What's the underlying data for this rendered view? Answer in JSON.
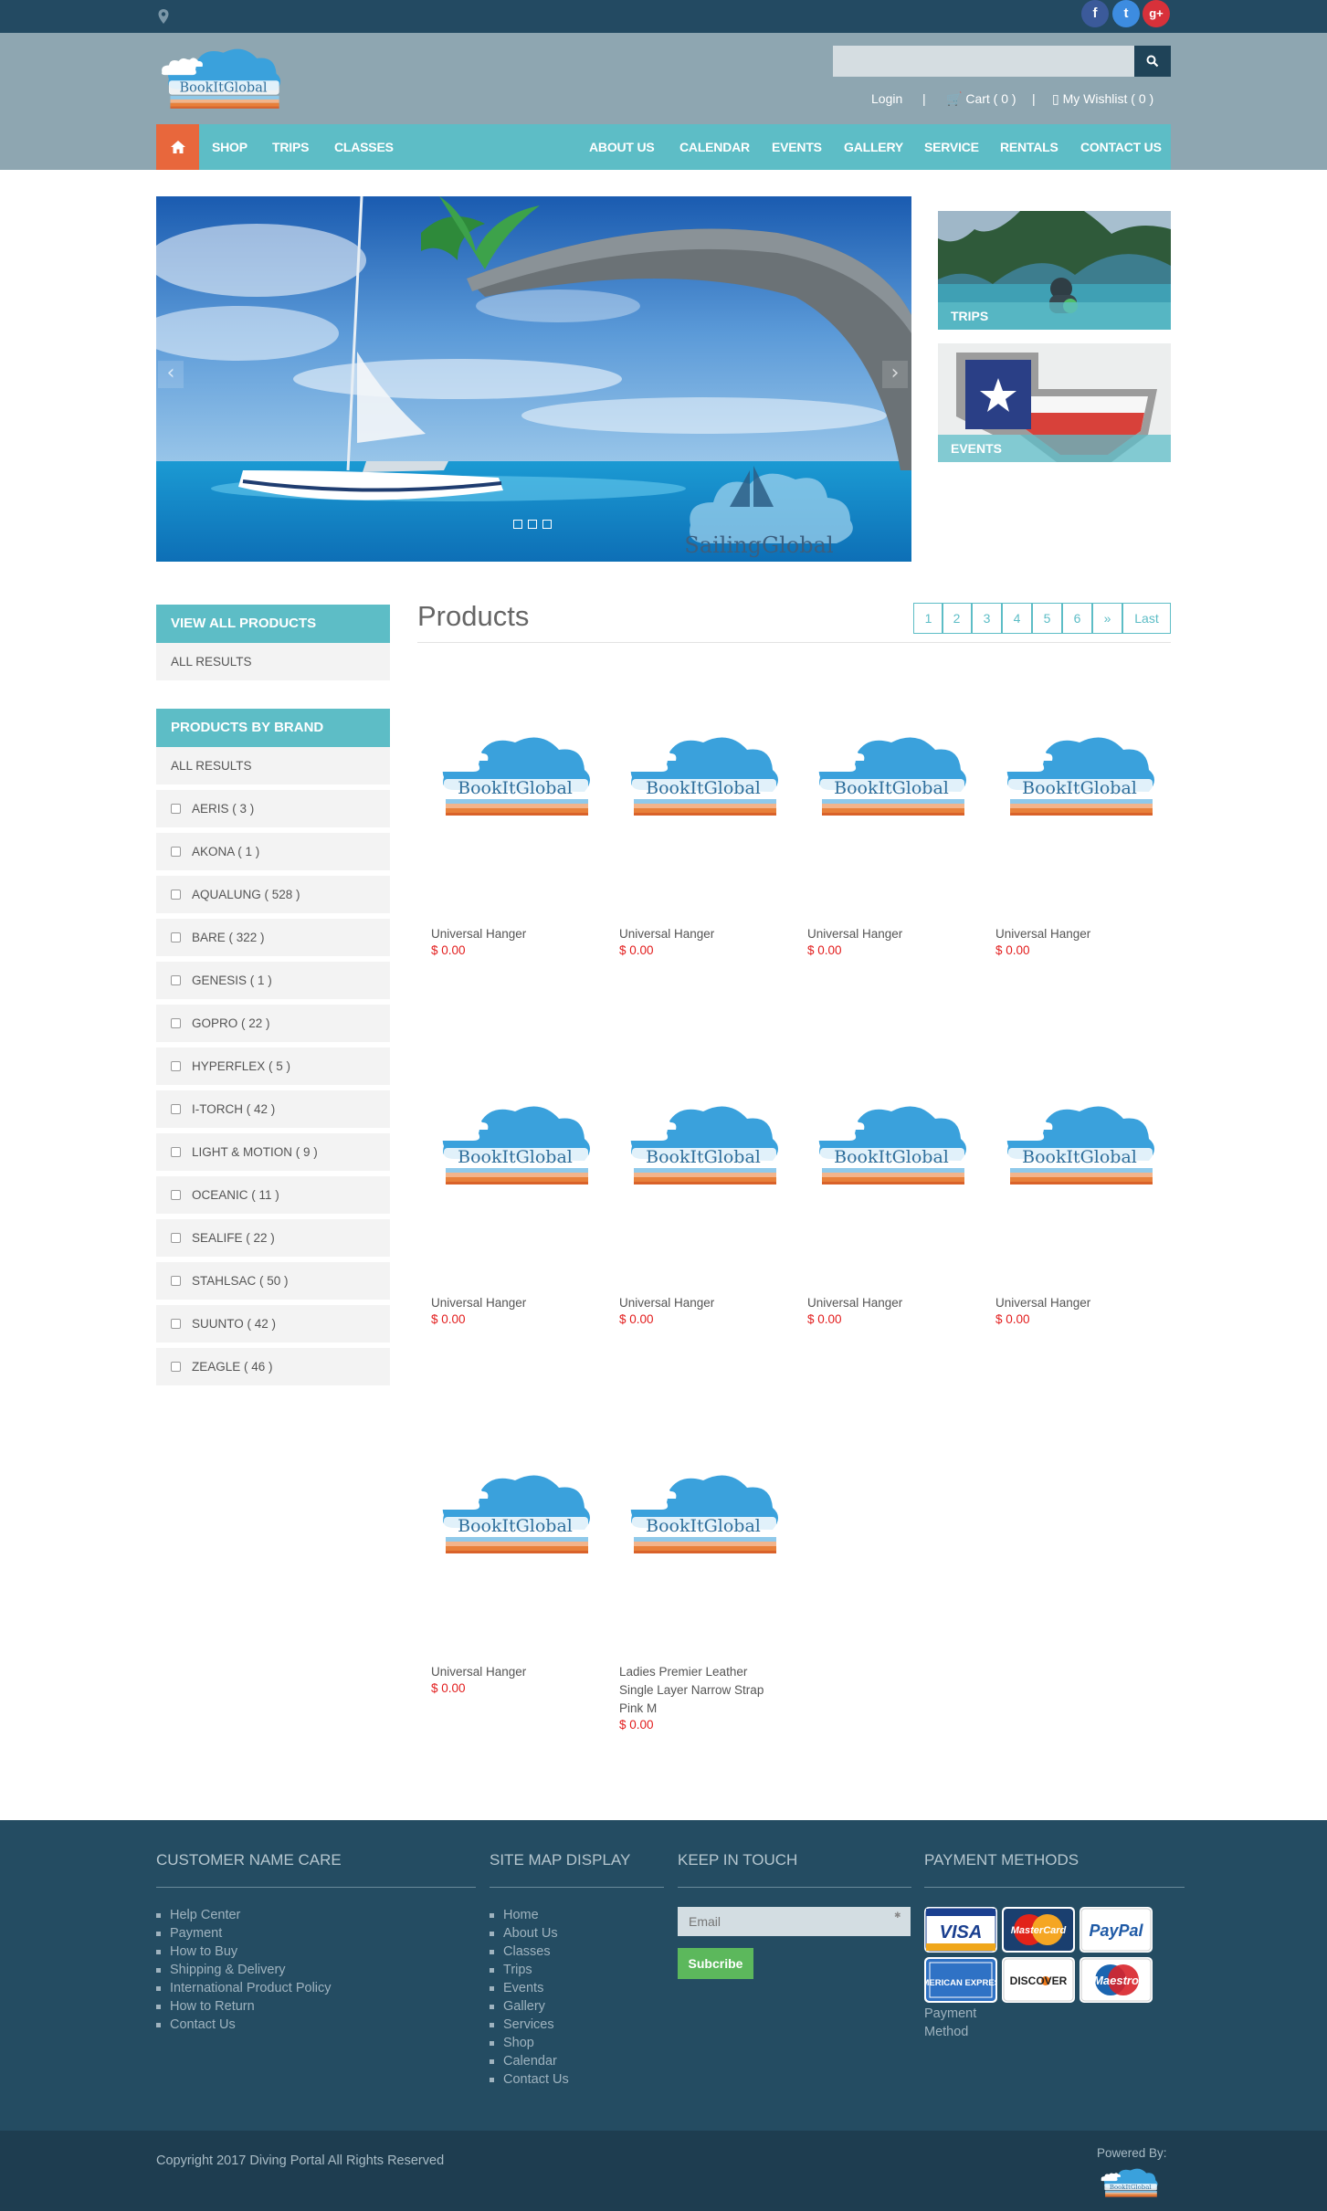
{
  "topbar": {
    "social": [
      "f",
      "t",
      "g+"
    ]
  },
  "header": {
    "logo_text": "BookItGlobal",
    "search": {
      "placeholder": ""
    },
    "account": {
      "login": "Login",
      "separator": "|",
      "cart": "Cart ( 0 )",
      "wishlist": "My Wishlist ( 0 )"
    }
  },
  "nav": {
    "left": [
      "SHOP",
      "TRIPS",
      "CLASSES"
    ],
    "right": [
      "ABOUT US",
      "CALENDAR",
      "EVENTS",
      "GALLERY",
      "SERVICE",
      "RENTALS",
      "CONTACT US"
    ]
  },
  "hero": {
    "watermark": "SailingGlobal",
    "tiles": [
      "TRIPS",
      "EVENTS"
    ],
    "slide_count": 3
  },
  "sidebar": {
    "view_all": {
      "title": "VIEW ALL PRODUCTS",
      "all_results": "ALL RESULTS"
    },
    "by_brand": {
      "title": "PRODUCTS BY BRAND",
      "all_results": "ALL RESULTS",
      "brands": [
        "AERIS ( 3 )",
        "AKONA ( 1 )",
        "AQUALUNG ( 528 )",
        "BARE ( 322 )",
        "GENESIS ( 1 )",
        "GOPRO ( 22 )",
        "HYPERFLEX ( 5 )",
        "I-TORCH ( 42 )",
        "LIGHT & MOTION ( 9 )",
        "OCEANIC ( 11 )",
        "SEALIFE ( 22 )",
        "STAHLSAC ( 50 )",
        "SUUNTO ( 42 )",
        "ZEAGLE ( 46 )"
      ]
    }
  },
  "products": {
    "title": "Products",
    "pagination": [
      "1",
      "2",
      "3",
      "4",
      "5",
      "6",
      "»",
      "Last"
    ],
    "items": [
      {
        "name": "Universal Hanger",
        "price": "$ 0.00"
      },
      {
        "name": "Universal Hanger",
        "price": "$ 0.00"
      },
      {
        "name": "Universal Hanger",
        "price": "$ 0.00"
      },
      {
        "name": "Universal Hanger",
        "price": "$ 0.00"
      },
      {
        "name": "Universal Hanger",
        "price": "$ 0.00"
      },
      {
        "name": "Universal Hanger",
        "price": "$ 0.00"
      },
      {
        "name": "Universal Hanger",
        "price": "$ 0.00"
      },
      {
        "name": "Universal Hanger",
        "price": "$ 0.00"
      },
      {
        "name": "Universal Hanger",
        "price": "$ 0.00"
      },
      {
        "name": "Ladies Premier Leather Single Layer Narrow Strap Pink M",
        "price": "$ 0.00"
      }
    ]
  },
  "footer": {
    "customer_care": {
      "title": "CUSTOMER NAME CARE",
      "links": [
        "Help Center",
        "Payment",
        "How to Buy",
        "Shipping & Delivery",
        "International Product Policy",
        "How to Return",
        "Contact Us"
      ]
    },
    "site_map": {
      "title": "SITE MAP DISPLAY",
      "links": [
        "Home",
        "About Us",
        "Classes",
        "Trips",
        "Events",
        "Gallery",
        "Services",
        "Shop",
        "Calendar",
        "Contact Us"
      ]
    },
    "keep_in_touch": {
      "title": "KEEP IN TOUCH",
      "email_placeholder": "Email",
      "subscribe": "Subcribe"
    },
    "payment": {
      "title": "PAYMENT METHODS",
      "cards": [
        "VISA",
        "MasterCard",
        "PayPal",
        "AMERICAN EXPRESS",
        "DISCOVER",
        "Maestro"
      ],
      "note": "Payment Method"
    },
    "copyright": "Copyright 2017 Diving Portal All Rights Reserved",
    "powered_by": "Powered By:"
  },
  "colors": {
    "topbar": "#234a62",
    "header": "#8ea6b1",
    "nav": "#5dbdc6",
    "home": "#e8673c",
    "price": "#e21c1c",
    "footer": "#244c62",
    "subscribe": "#5cb85c"
  }
}
